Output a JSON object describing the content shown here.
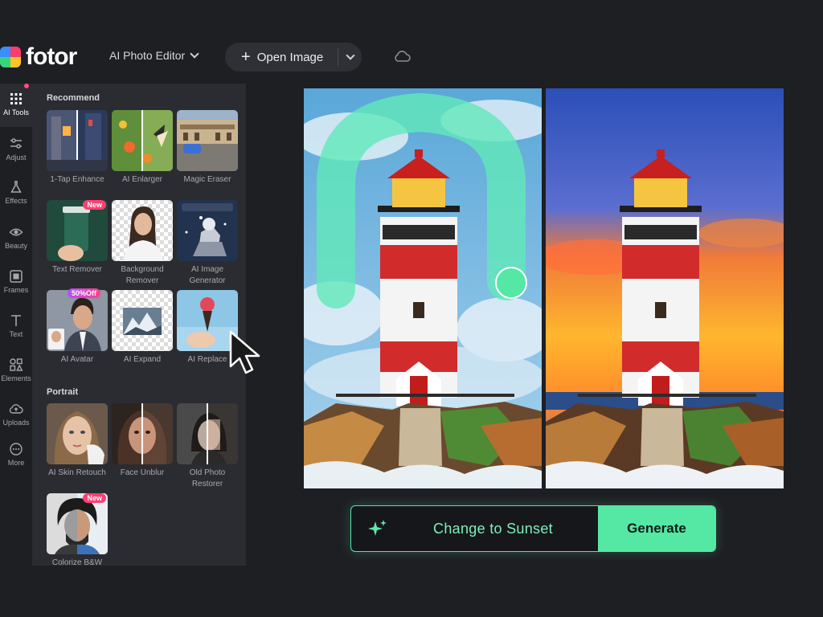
{
  "app": {
    "logo_text": "fotor",
    "editor_menu_label": "AI Photo Editor",
    "open_image_label": "Open Image"
  },
  "rail": [
    {
      "label": "AI Tools",
      "icon": "grid-icon",
      "active": true
    },
    {
      "label": "Adjust",
      "icon": "sliders-icon"
    },
    {
      "label": "Effects",
      "icon": "flask-icon"
    },
    {
      "label": "Beauty",
      "icon": "eye-icon"
    },
    {
      "label": "Frames",
      "icon": "frame-icon"
    },
    {
      "label": "Text",
      "icon": "text-icon"
    },
    {
      "label": "Elements",
      "icon": "shapes-icon"
    },
    {
      "label": "Uploads",
      "icon": "cloud-upload-icon"
    },
    {
      "label": "More",
      "icon": "more-icon"
    }
  ],
  "panel": {
    "recommend_title": "Recommend",
    "portrait_title": "Portrait",
    "recommend_tools": [
      {
        "label": "1-Tap Enhance"
      },
      {
        "label": "AI Enlarger"
      },
      {
        "label": "Magic Eraser"
      },
      {
        "label": "Text Remover",
        "badge": "New"
      },
      {
        "label": "Background Remover"
      },
      {
        "label": "AI Image Generator"
      },
      {
        "label": "AI Avatar",
        "badge": "50%Off"
      },
      {
        "label": "AI Expand"
      },
      {
        "label": "AI Replace"
      }
    ],
    "portrait_tools": [
      {
        "label": "AI Skin Retouch"
      },
      {
        "label": "Face Unblur"
      },
      {
        "label": "Old Photo Restorer"
      },
      {
        "label": "Colorize B&W",
        "badge": "New"
      }
    ]
  },
  "prompt": {
    "text": "Change to Sunset",
    "generate_label": "Generate"
  },
  "colors": {
    "accent": "#55e8a5",
    "badge_new": "#ff3f73",
    "panel_bg": "#2a2c31",
    "page_bg": "#1e1f23"
  }
}
